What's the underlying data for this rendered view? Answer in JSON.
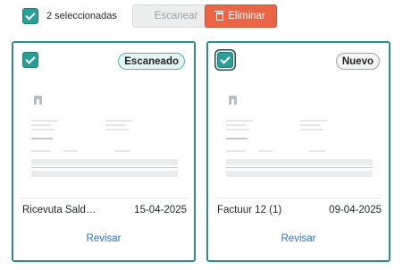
{
  "toolbar": {
    "selection_text": "2 seleccionadas",
    "scan_label": "Escanear",
    "delete_label": "Eliminar"
  },
  "cards": [
    {
      "status": "Escaneado",
      "name": "Ricevuta Sald…",
      "date": "15-04-2025",
      "review_label": "Revisar",
      "selected": true
    },
    {
      "status": "Nuevo",
      "name": "Factuur 12 (1)",
      "date": "09-04-2025",
      "review_label": "Revisar",
      "selected": true
    }
  ],
  "colors": {
    "accent": "#2a8e89",
    "danger": "#ea6446",
    "link": "#2f72c4"
  },
  "icons": [
    "check-icon",
    "trash-icon",
    "document-logo-icon"
  ]
}
